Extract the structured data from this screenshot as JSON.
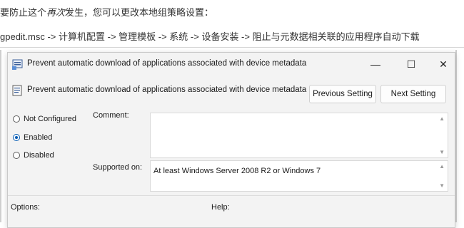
{
  "article": {
    "line1_part1": "要防止这个",
    "line1_emph": "再次",
    "line1_part2": "发生，您可以更改本地组策略设置：",
    "line2": "gpedit.msc -> 计算机配置 -> 管理模板 -> 系统 -> 设备安装 -> 阻止与元数据相关联的应用程序自动下载"
  },
  "dialog": {
    "title": "Prevent automatic download of applications associated with device metadata",
    "header_title": "Prevent automatic download of applications associated with device metadata",
    "window_controls": {
      "minimize": "—",
      "maximize": "☐",
      "close": "✕"
    },
    "buttons": {
      "previous": "Previous Setting",
      "next": "Next Setting"
    },
    "radio_options": [
      {
        "label": "Not Configured",
        "selected": false
      },
      {
        "label": "Enabled",
        "selected": true
      },
      {
        "label": "Disabled",
        "selected": false
      }
    ],
    "comment_label": "Comment:",
    "comment_value": "",
    "supported_label": "Supported on:",
    "supported_value": "At least Windows Server 2008 R2 or Windows 7",
    "options_label": "Options:",
    "help_label": "Help:",
    "scroll_up": "▲",
    "scroll_down": "▼"
  },
  "colors": {
    "accent": "#0059b3",
    "dialog_bg": "#f3f3f3"
  },
  "icons": {
    "title_icon": "policy-settings-icon",
    "header_icon": "policy-document-icon"
  }
}
